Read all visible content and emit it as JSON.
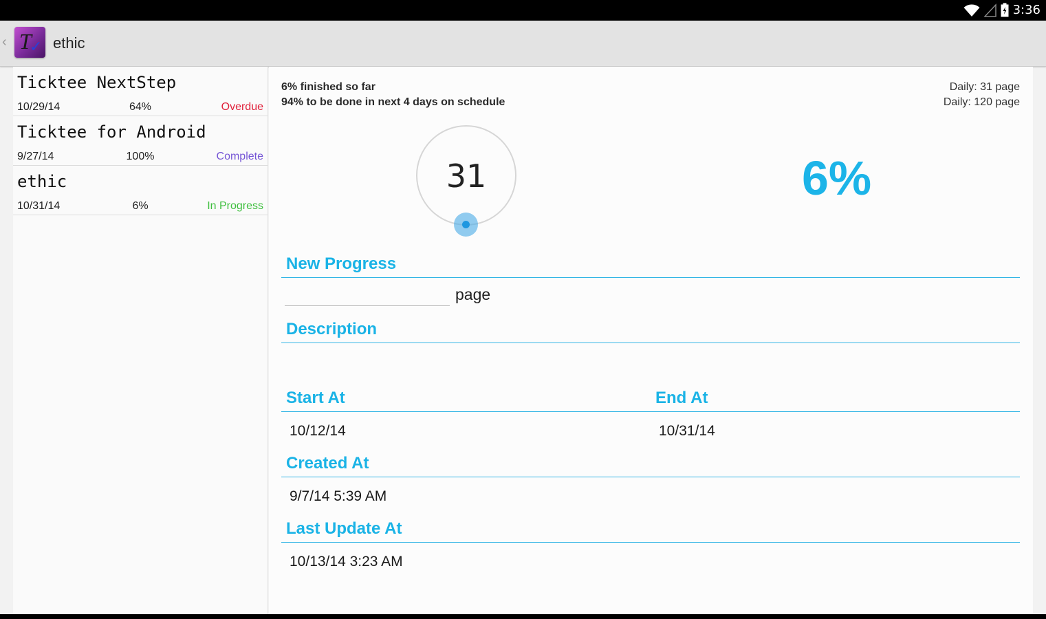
{
  "status_bar": {
    "time": "3:36",
    "icons": [
      "wifi-icon",
      "signal-icon",
      "battery-icon"
    ]
  },
  "action_bar": {
    "title": "ethic",
    "app_icon": "ticktee-app-icon"
  },
  "projects": [
    {
      "title": "Ticktee NextStep",
      "date": "10/29/14",
      "percent": "64%",
      "status": "Overdue",
      "status_color": "#e0203a"
    },
    {
      "title": "Ticktee for Android",
      "date": "9/27/14",
      "percent": "100%",
      "status": "Complete",
      "status_color": "#7656d6"
    },
    {
      "title": "ethic",
      "date": "10/31/14",
      "percent": "6%",
      "status": "In Progress",
      "status_color": "#3fbf3f"
    }
  ],
  "detail": {
    "summary_finished": "6% finished so far",
    "summary_remaining": "94% to be done in next 4 days on schedule",
    "daily_current": "Daily: 31 page",
    "daily_target": "Daily: 120 page",
    "dial_value": "31",
    "percent": "6%",
    "new_progress": {
      "label": "New Progress",
      "value": "",
      "placeholder": "",
      "unit": "page"
    },
    "description": {
      "label": "Description",
      "value": ""
    },
    "start_at": {
      "label": "Start At",
      "value": "10/12/14"
    },
    "end_at": {
      "label": "End At",
      "value": "10/31/14"
    },
    "created_at": {
      "label": "Created At",
      "value": "9/7/14 5:39 AM"
    },
    "last_update_at": {
      "label": "Last Update At",
      "value": "10/13/14 3:23 AM"
    }
  },
  "colors": {
    "accent": "#33b5e5",
    "percent_text": "#1cb4e8"
  }
}
